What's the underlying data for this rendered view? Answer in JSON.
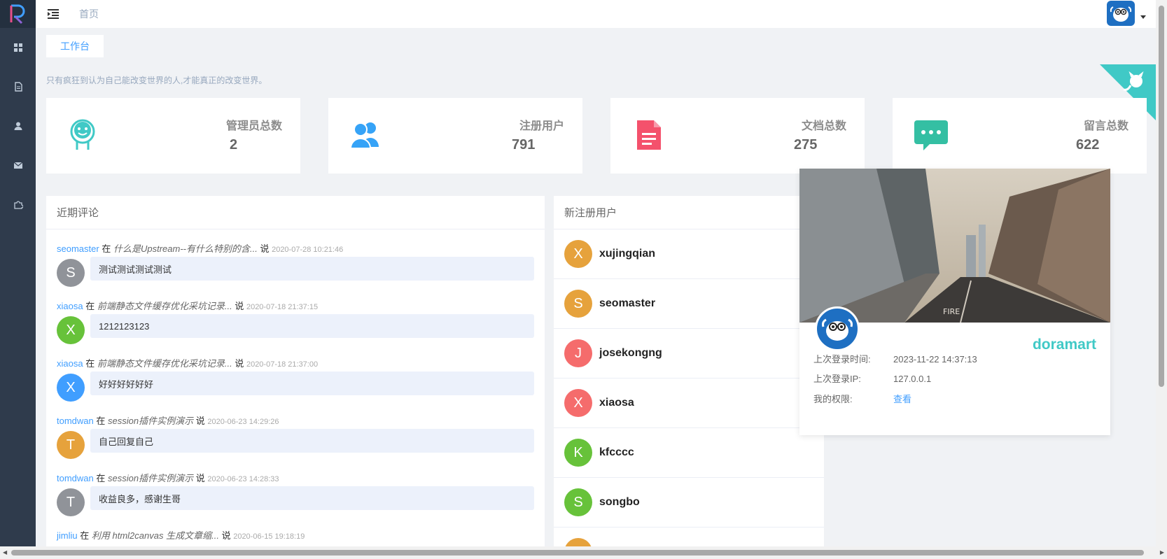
{
  "header": {
    "breadcrumb": "首页"
  },
  "tags": {
    "active": "工作台"
  },
  "motto": "只有疯狂到认为自己能改变世界的人,才能真正的改变世界。",
  "stats": [
    {
      "label": "管理员总数",
      "value": "2",
      "icon": "robot-icon",
      "color": "#40c9c6"
    },
    {
      "label": "注册用户",
      "value": "791",
      "icon": "people-icon",
      "color": "#36a3f7"
    },
    {
      "label": "文档总数",
      "value": "275",
      "icon": "document-icon",
      "color": "#f4516c"
    },
    {
      "label": "留言总数",
      "value": "622",
      "icon": "message-icon",
      "color": "#34bfa3"
    }
  ],
  "comments": {
    "title": "近期评论",
    "in_word": "在",
    "say_word": "说",
    "items": [
      {
        "user": "seomaster",
        "title": "什么是Upstream--有什么特别的含...",
        "time": "2020-07-28 10:21:46",
        "initial": "S",
        "color": "#909399",
        "content": "测试测试测试测试"
      },
      {
        "user": "xiaosa",
        "title": "前端静态文件缓存优化采坑记录...",
        "time": "2020-07-18 21:37:15",
        "initial": "X",
        "color": "#67c23a",
        "content": "1212123123"
      },
      {
        "user": "xiaosa",
        "title": "前端静态文件缓存优化采坑记录...",
        "time": "2020-07-18 21:37:00",
        "initial": "X",
        "color": "#409eff",
        "content": "好好好好好好"
      },
      {
        "user": "tomdwan",
        "title": "session插件实例演示",
        "time": "2020-06-23 14:29:26",
        "initial": "T",
        "color": "#e6a23c",
        "content": "自己回复自己"
      },
      {
        "user": "tomdwan",
        "title": "session插件实例演示",
        "time": "2020-06-23 14:28:33",
        "initial": "T",
        "color": "#909399",
        "content": "收益良多，感谢生哥"
      },
      {
        "user": "jimliu",
        "title": "利用 html2canvas 生成文章缩...",
        "time": "2020-06-15 19:18:19",
        "initial": "",
        "color": "#ffffff",
        "content": ""
      }
    ]
  },
  "new_users": {
    "title": "新注册用户",
    "items": [
      {
        "name": "xujingqian",
        "initial": "X",
        "color": "#e6a23c"
      },
      {
        "name": "seomaster",
        "initial": "S",
        "color": "#e6a23c"
      },
      {
        "name": "josekongng",
        "initial": "J",
        "color": "#f56c6c"
      },
      {
        "name": "xiaosa",
        "initial": "X",
        "color": "#f56c6c"
      },
      {
        "name": "kfcccc",
        "initial": "K",
        "color": "#67c23a"
      },
      {
        "name": "songbo",
        "initial": "S",
        "color": "#67c23a"
      },
      {
        "name": "",
        "initial": "",
        "color": "#e6a23c"
      }
    ]
  },
  "profile": {
    "name": "doramart",
    "last_login_time_label": "上次登录时间:",
    "last_login_time": "2023-11-22 14:37:13",
    "last_login_ip_label": "上次登录IP:",
    "last_login_ip": "127.0.0.1",
    "permission_label": "我的权限:",
    "permission_link": "查看"
  }
}
